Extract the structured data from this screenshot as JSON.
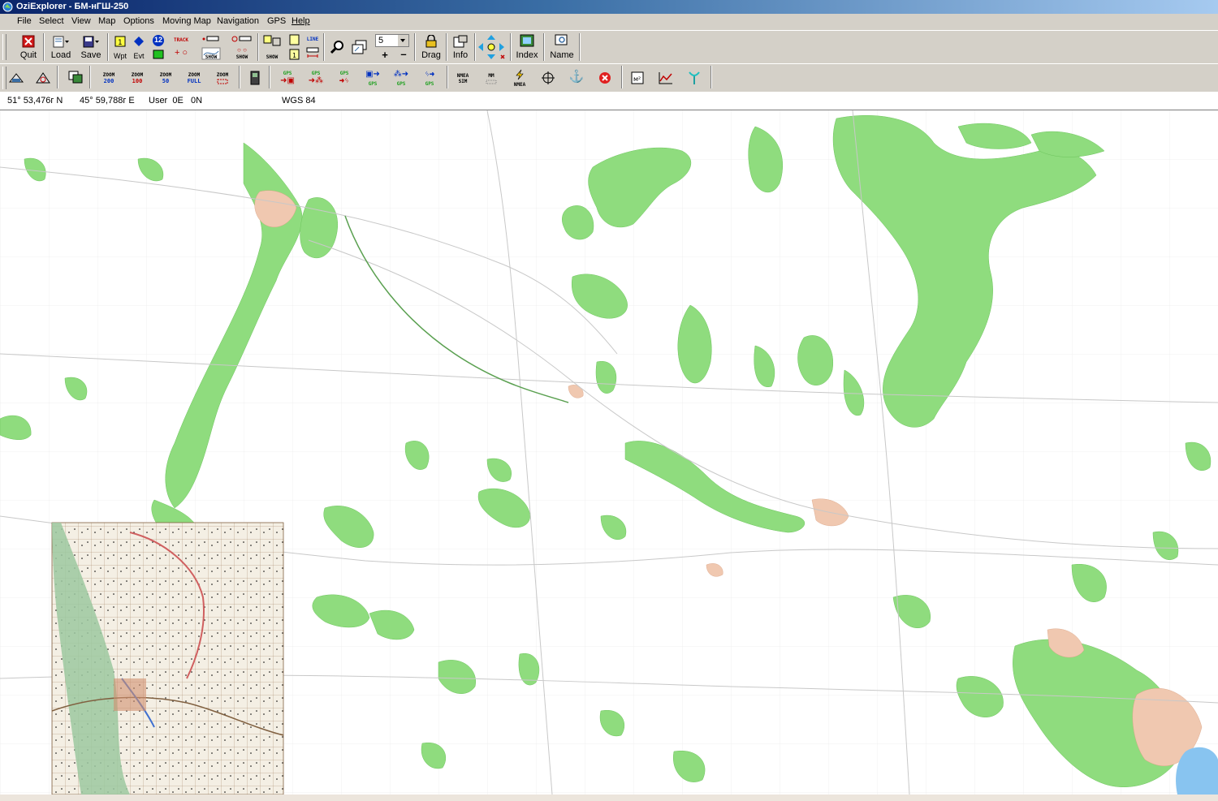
{
  "window": {
    "title": "OziExplorer - БМ-нГШ-250"
  },
  "menu": [
    "File",
    "Select",
    "View",
    "Map",
    "Options",
    "Moving Map",
    "Navigation",
    "GPS",
    "Help"
  ],
  "toolbar1": {
    "quit": "Quit",
    "load": "Load",
    "save": "Save",
    "wpt": "Wpt",
    "evt": "Evt",
    "wpt_number": "12",
    "track": "TRACK",
    "show": "SHOW",
    "line": "LINE",
    "zoom_value": "5",
    "drag": "Drag",
    "info": "Info",
    "index": "Index",
    "name": "Name"
  },
  "toolbar2": {
    "zoom200": [
      "ZOOM",
      "200"
    ],
    "zoom100": [
      "ZOOM",
      "100"
    ],
    "zoom50": [
      "ZOOM",
      "50"
    ],
    "zoomfull": [
      "ZOOM",
      "FULL"
    ],
    "zoom_box": "ZOOM",
    "gps": "GPS",
    "nmea": "NMEA",
    "nmea_sim": [
      "NMEA",
      "SIM"
    ],
    "mm": "MM"
  },
  "status": {
    "lat": "51° 53,476г N",
    "lon": "45° 59,788г E",
    "user": "User  0E   0N",
    "datum": "WGS 84"
  },
  "colors": {
    "forest": "#8fdc7e",
    "forest_dark": "#6cc45c",
    "title_start": "#0a246a",
    "title_end": "#a6caf0",
    "road": "#c8c8c8",
    "rail": "#5aa050"
  }
}
